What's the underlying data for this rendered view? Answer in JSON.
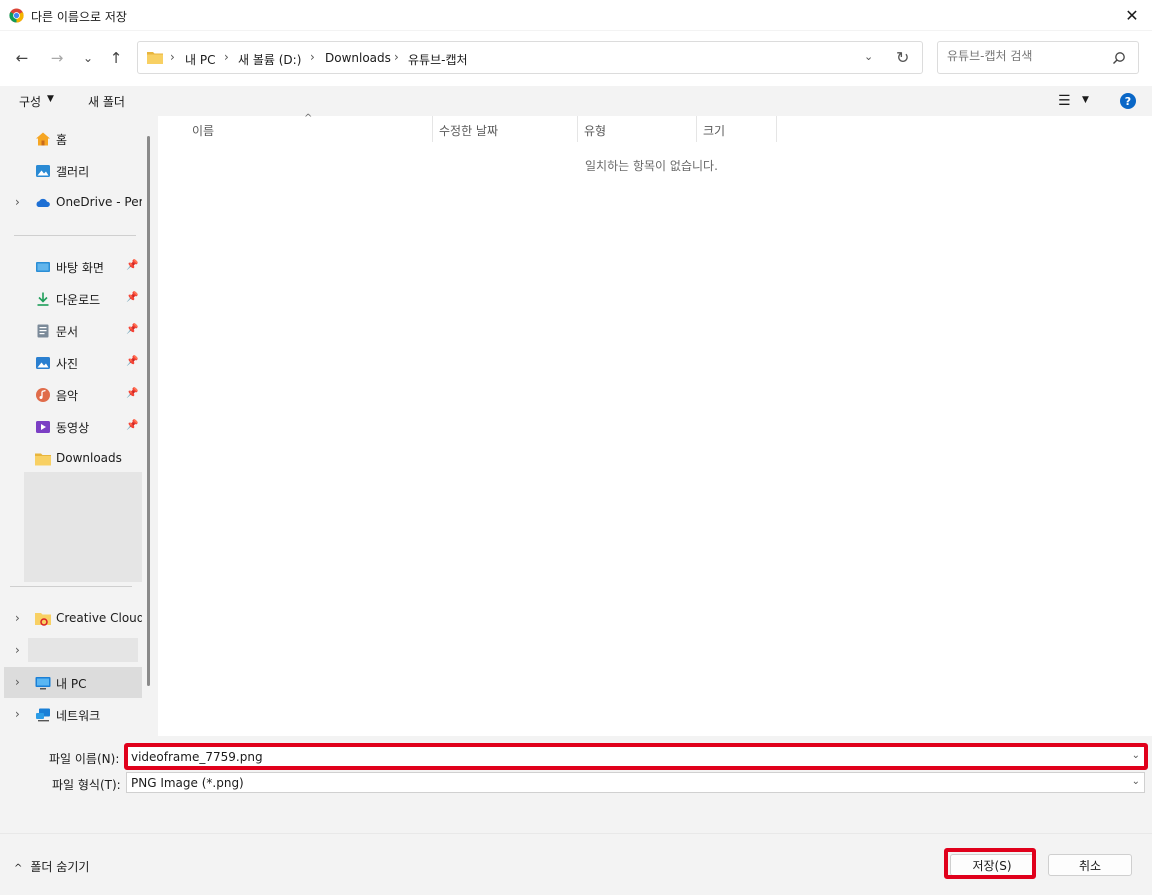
{
  "window": {
    "title": "다른 이름으로 저장",
    "close_icon": "✕"
  },
  "nav": {
    "back_icon": "←",
    "forward_icon": "→",
    "recent_icon": "⌄",
    "up_icon": "↑",
    "breadcrumbs": [
      "내 PC",
      "새 볼륨 (D:)",
      "Downloads",
      "유튜브-캡처"
    ],
    "search_placeholder": "유튜브-캡처 검색"
  },
  "toolbar": {
    "organize_label": "구성",
    "new_folder_label": "새 폴더",
    "help_label": "?"
  },
  "sidebar": {
    "items": [
      {
        "label": "홈",
        "icon": "home-icon",
        "expandable": false,
        "pinned": false
      },
      {
        "label": "갤러리",
        "icon": "gallery-icon",
        "expandable": false,
        "pinned": false
      },
      {
        "label": "OneDrive - Personal",
        "icon": "onedrive-icon",
        "expandable": true,
        "pinned": false
      },
      {
        "label": "바탕 화면",
        "icon": "desktop-icon",
        "expandable": false,
        "pinned": true
      },
      {
        "label": "다운로드",
        "icon": "download-icon",
        "expandable": false,
        "pinned": true
      },
      {
        "label": "문서",
        "icon": "document-icon",
        "expandable": false,
        "pinned": true
      },
      {
        "label": "사진",
        "icon": "pictures-icon",
        "expandable": false,
        "pinned": true
      },
      {
        "label": "음악",
        "icon": "music-icon",
        "expandable": false,
        "pinned": true
      },
      {
        "label": "동영상",
        "icon": "video-icon",
        "expandable": false,
        "pinned": true
      },
      {
        "label": "Downloads",
        "icon": "folder-icon",
        "expandable": false,
        "pinned": false
      },
      {
        "label": "Creative Cloud",
        "icon": "creative-cloud-icon",
        "expandable": true,
        "pinned": false
      },
      {
        "label": "",
        "icon": "",
        "expandable": true,
        "pinned": false
      },
      {
        "label": "내 PC",
        "icon": "pc-icon",
        "expandable": true,
        "pinned": false,
        "selected": true
      },
      {
        "label": "네트워크",
        "icon": "network-icon",
        "expandable": true,
        "pinned": false
      }
    ]
  },
  "columns": [
    "이름",
    "수정한 날짜",
    "유형",
    "크기"
  ],
  "empty_message": "일치하는 항목이 없습니다.",
  "form": {
    "filename_label": "파일 이름(N):",
    "filename_value": "videoframe_7759.png",
    "filetype_label": "파일 형식(T):",
    "filetype_value": "PNG Image (*.png)"
  },
  "footer": {
    "hide_folders_label": "폴더 숨기기",
    "save_label": "저장(S)",
    "cancel_label": "취소"
  },
  "colors": {
    "highlight": "#e0001b",
    "accent": "#0a67c7"
  }
}
